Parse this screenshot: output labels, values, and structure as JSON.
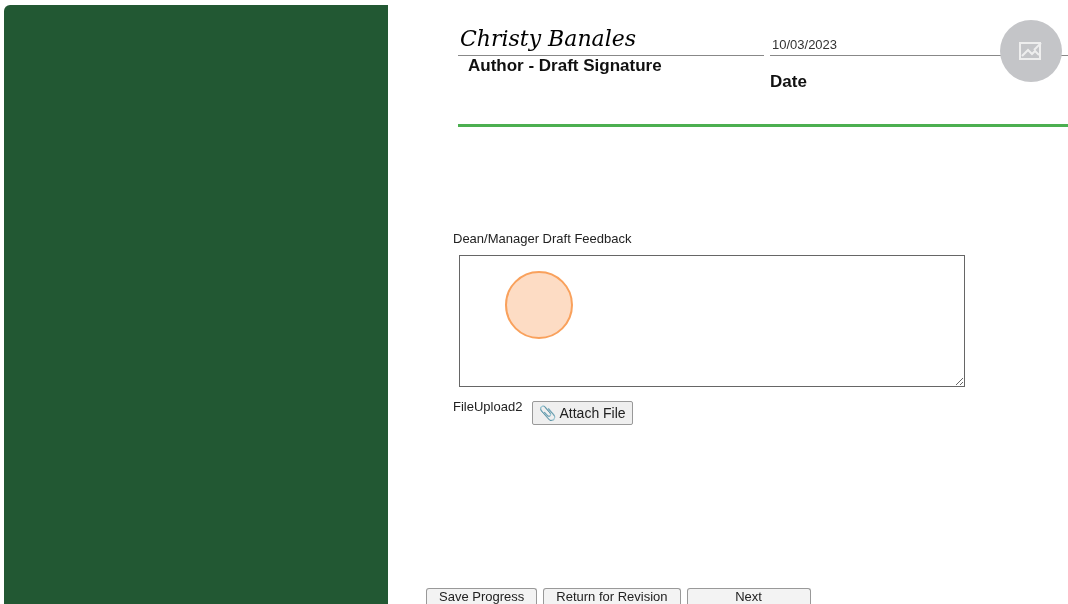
{
  "signature": {
    "name": "Christy Banales",
    "label": "Author - Draft  Signature"
  },
  "date": {
    "value": "10/03/2023",
    "label": "Date"
  },
  "feedback": {
    "label": "Dean/Manager Draft Feedback"
  },
  "upload": {
    "label": "FileUpload2",
    "button": "📎 Attach File"
  },
  "buttons": [
    "Save Progress",
    "Return for Revision",
    "Next"
  ]
}
